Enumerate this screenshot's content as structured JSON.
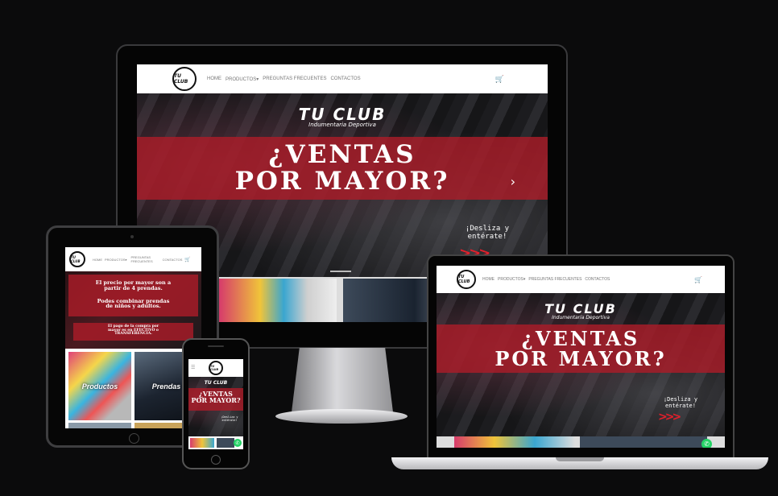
{
  "site": {
    "logo_text": "TU CLUB",
    "nav": {
      "home": "HOME",
      "productos": "PRODUCTOS",
      "faq": "PREGUNTAS FRECUENTES",
      "faq_line1": "PREGUNTAS",
      "faq_line2": "FRECUENTES",
      "contactos": "CONTACTOS",
      "dropdown_caret": "▾",
      "cart_icon": "cart-icon"
    },
    "hero": {
      "brand": "TU CLUB",
      "brand_sub": "Indumentaria Deportiva",
      "headline_line1": "¿VENTAS",
      "headline_line2": "POR MAYOR?",
      "slide_text_line1": "¡Desliza y",
      "slide_text_line2": "entérate!",
      "arrows": ">>>",
      "next_arrow": "›"
    },
    "tablet_slide": {
      "line1": "El precio por mayor son a",
      "line2": "partir de 4 prendas.",
      "line3": "Podes combinar prendas",
      "line4": "de niños y adultos.",
      "line5": "El pago de la compra por",
      "line6": "mayor es en EFECTIVO o",
      "line7": "TRANSFERENCIA."
    },
    "categories": {
      "productos": "Productos",
      "prendas": "Prendas"
    },
    "whatsapp_icon": "whatsapp-icon"
  },
  "colors": {
    "background": "#0b0b0c",
    "accent_red": "#aa1c28",
    "arrow_red": "#e21f2b",
    "whatsapp_green": "#25d366"
  }
}
